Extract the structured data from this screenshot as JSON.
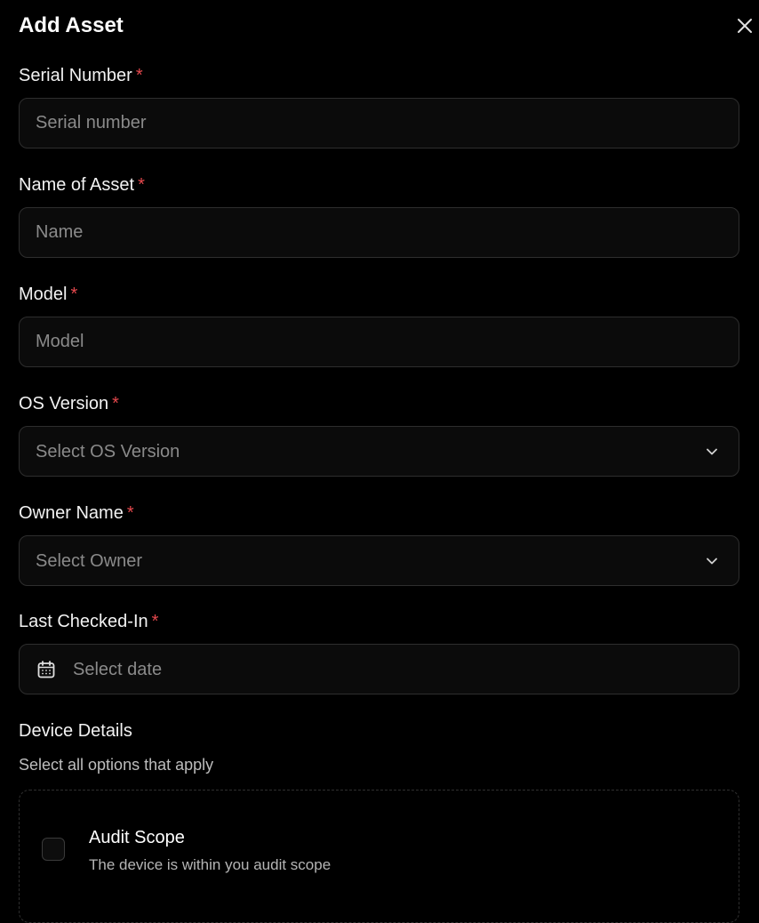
{
  "dialog": {
    "title": "Add Asset",
    "close_icon": "close-icon"
  },
  "required_marker": "*",
  "fields": {
    "serial_number": {
      "label": "Serial Number",
      "placeholder": "Serial number",
      "value": ""
    },
    "name": {
      "label": "Name of Asset",
      "placeholder": "Name",
      "value": ""
    },
    "model": {
      "label": "Model",
      "placeholder": "Model",
      "value": ""
    },
    "os_version": {
      "label": "OS Version",
      "placeholder": "Select OS Version",
      "icon": "chevron-down-icon"
    },
    "owner": {
      "label": "Owner Name",
      "placeholder": "Select Owner",
      "icon": "chevron-down-icon"
    },
    "last_checked_in": {
      "label": "Last Checked-In",
      "placeholder": "Select date",
      "icon": "calendar-icon"
    }
  },
  "device_details": {
    "title": "Device Details",
    "subtitle": "Select all options that apply",
    "options": [
      {
        "title": "Audit Scope",
        "description": "The device is within you audit scope",
        "checked": false
      }
    ]
  },
  "colors": {
    "background": "#000000",
    "field_border": "#2e2e2e",
    "placeholder": "#8a8a8a",
    "required": "#e5484d"
  }
}
